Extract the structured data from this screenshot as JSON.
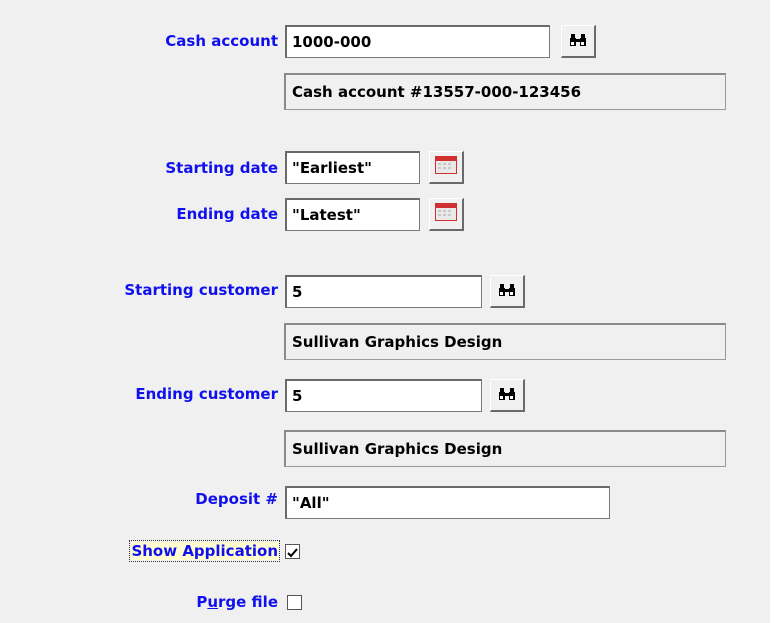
{
  "form": {
    "cash_account": {
      "label": "Cash account",
      "value": "1000-000",
      "description": "Cash account #13557-000-123456"
    },
    "starting_date": {
      "label": "Starting date",
      "value": "\"Earliest\""
    },
    "ending_date": {
      "label": "Ending date",
      "value": "\"Latest\""
    },
    "starting_customer": {
      "label": "Starting customer",
      "value": "5",
      "description": "Sullivan Graphics Design"
    },
    "ending_customer": {
      "label": "Ending customer",
      "value": "5",
      "description": "Sullivan Graphics Design"
    },
    "deposit": {
      "label": "Deposit #",
      "value": "\"All\""
    },
    "show_application": {
      "label": "Show Application",
      "checked": true
    },
    "purge_file": {
      "label_prefix": "P",
      "label_underlined": "u",
      "label_suffix": "rge file",
      "checked": false
    }
  },
  "icons": {
    "lookup": "binoculars-icon",
    "calendar": "calendar-icon"
  },
  "colors": {
    "label": "#1010ee",
    "panel_bg": "#f0f0f0"
  }
}
